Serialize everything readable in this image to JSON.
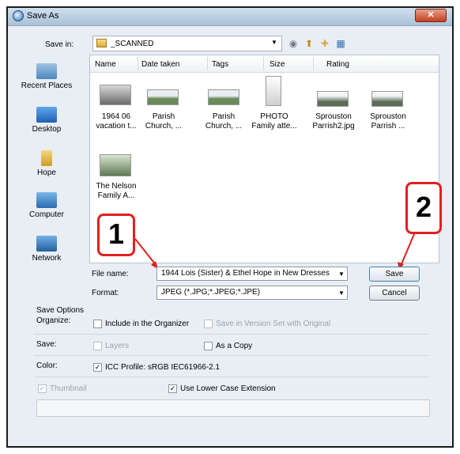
{
  "window": {
    "title": "Save As",
    "close_glyph": "✕"
  },
  "toolbar": {
    "save_in_label": "Save in:",
    "save_in_value": "_SCANNED",
    "icons": [
      "back-icon",
      "up-folder-icon",
      "new-folder-icon",
      "views-icon"
    ]
  },
  "places": [
    {
      "label": "Recent Places",
      "icon": "recent-places-icon"
    },
    {
      "label": "Desktop",
      "icon": "desktop-icon"
    },
    {
      "label": "Hope",
      "icon": "user-folder-icon"
    },
    {
      "label": "Computer",
      "icon": "computer-icon"
    },
    {
      "label": "Network",
      "icon": "network-icon"
    }
  ],
  "columns": [
    "Name",
    "Date taken",
    "Tags",
    "Size",
    "Rating"
  ],
  "files": [
    {
      "line1": "1964 06",
      "line2": "vacation t..."
    },
    {
      "line1": "Parish",
      "line2": "Church, ..."
    },
    {
      "line1": "Parish",
      "line2": "Church, ..."
    },
    {
      "line1": "PHOTO",
      "line2": "Family atte..."
    },
    {
      "line1": "Sprouston",
      "line2": "Parrish2.jpg"
    },
    {
      "line1": "Sprouston",
      "line2": "Parrish ..."
    },
    {
      "line1": "The Nelson",
      "line2": "Family A..."
    }
  ],
  "callouts": {
    "one": "1",
    "two": "2"
  },
  "filename": {
    "label": "File name:",
    "value": "1944 Lois (Sister) & Ethel Hope in New Dresses"
  },
  "format": {
    "label": "Format:",
    "value": "JPEG (*.JPG;*.JPEG;*.JPE)"
  },
  "buttons": {
    "save": "Save",
    "cancel": "Cancel"
  },
  "options": {
    "header": "Save Options",
    "organize_label": "Organize:",
    "include_organizer": "Include in the Organizer",
    "version_set": "Save in Version Set with Original",
    "save_label": "Save:",
    "layers": "Layers",
    "as_copy": "As a Copy",
    "color_label": "Color:",
    "icc_profile": "ICC Profile:  sRGB IEC61966-2.1",
    "thumbnail": "Thumbnail",
    "lowercase_ext": "Use Lower Case Extension"
  }
}
